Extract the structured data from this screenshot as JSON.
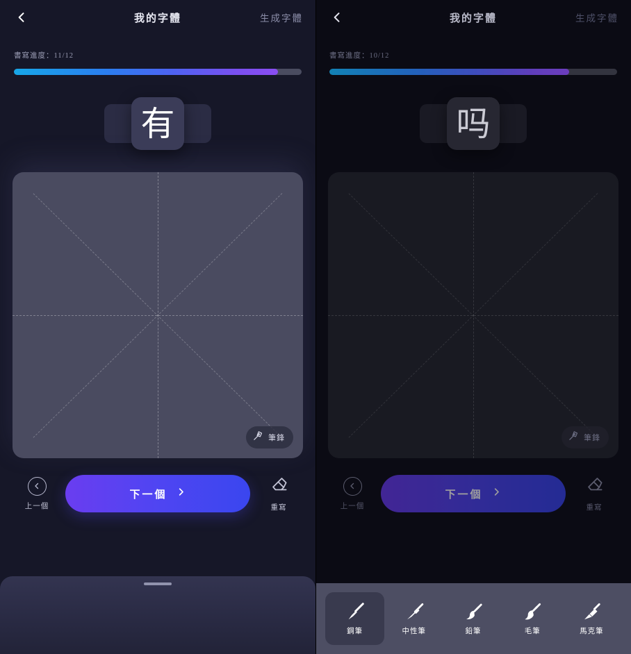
{
  "panels": [
    {
      "id": "active-panel",
      "header": {
        "back_icon": "chevron-left-icon",
        "title": "我的字體",
        "action_label": "生成字體"
      },
      "progress": {
        "label": "書寫進度：11/12",
        "current": 11,
        "total": 12,
        "percent": 91.7,
        "fill_gradient_start": "#17a7e8",
        "fill_gradient_end": "#8a4ef2",
        "track_color": "#4a4c60"
      },
      "character": {
        "glyph": "有",
        "chip_color": "#3b3c58",
        "text_color": "#ffffff"
      },
      "canvas": {
        "background": "#4a4b60",
        "guides": "dashed-cross-and-diagonals",
        "nib_button": {
          "icon": "pen-nib-icon",
          "label": "筆鋒"
        }
      },
      "actions": {
        "prev": {
          "icon": "chevron-left-circle-icon",
          "label": "上一個"
        },
        "next": {
          "label": "下一個",
          "icon": "chevron-right-icon",
          "gradient_start": "#6a3df0",
          "gradient_end": "#3a46ef"
        },
        "clear": {
          "icon": "eraser-icon",
          "label": "重寫"
        }
      },
      "bottom": {
        "type": "drag-sheet",
        "grabber": true
      }
    },
    {
      "id": "dimmed-panel",
      "header": {
        "back_icon": "chevron-left-icon",
        "title": "我的字體",
        "action_label": "生成字體"
      },
      "progress": {
        "label": "書寫進度：10/12",
        "current": 10,
        "total": 12,
        "percent": 83.3,
        "fill_gradient_start": "#17a7e8",
        "fill_gradient_end": "#8a4ef2",
        "track_color": "#33343f"
      },
      "character": {
        "glyph": "吗",
        "chip_color": "#272732",
        "text_color": "#cbcbd4"
      },
      "canvas": {
        "background": "#191a22",
        "guides": "dashed-cross-and-diagonals",
        "nib_button": {
          "icon": "pen-nib-icon",
          "label": "筆鋒"
        }
      },
      "actions": {
        "prev": {
          "icon": "chevron-left-circle-icon",
          "label": "上一個"
        },
        "next": {
          "label": "下一個",
          "icon": "chevron-right-icon",
          "gradient_start": "#6a3df0",
          "gradient_end": "#3a46ef"
        },
        "clear": {
          "icon": "eraser-icon",
          "label": "重寫"
        }
      },
      "bottom": {
        "type": "pen-picker",
        "background": "#4d4e63",
        "active_index": 0,
        "pens": [
          {
            "icon": "fountain-pen-icon",
            "label": "鋼筆"
          },
          {
            "icon": "gel-pen-icon",
            "label": "中性筆"
          },
          {
            "icon": "pencil-icon",
            "label": "鉛筆"
          },
          {
            "icon": "brush-pen-icon",
            "label": "毛筆"
          },
          {
            "icon": "marker-pen-icon",
            "label": "馬克筆"
          }
        ]
      }
    }
  ]
}
